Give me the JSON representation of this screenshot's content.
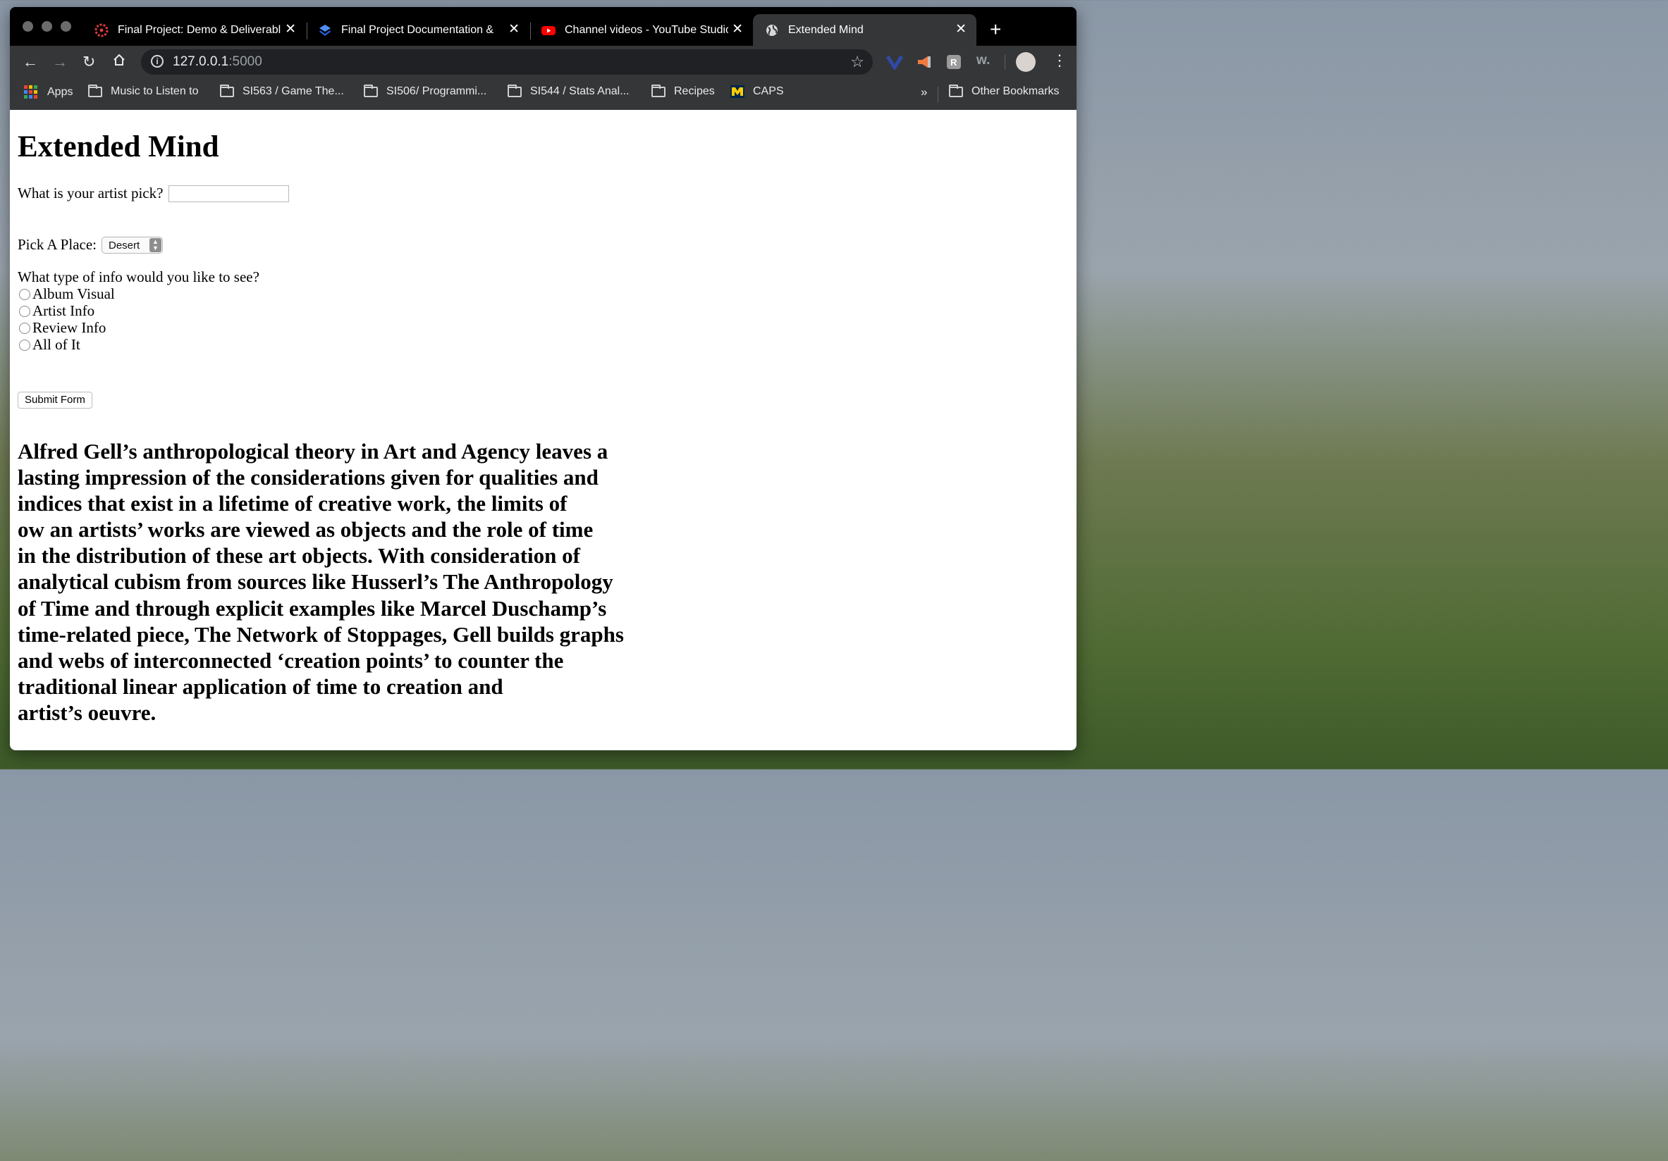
{
  "browser": {
    "tabs": [
      {
        "title": "Final Project: Demo & Deliverabl",
        "icon": "canvas-icon",
        "active": false
      },
      {
        "title": "Final Project Documentation & ",
        "icon": "layers-icon",
        "active": false
      },
      {
        "title": "Channel videos - YouTube Studio",
        "icon": "youtube-icon",
        "active": false
      },
      {
        "title": "Extended Mind",
        "icon": "globe-icon",
        "active": true
      }
    ],
    "url_host": "127.0.0.1",
    "url_port": ":5000",
    "bookmarks": [
      {
        "label": "Apps",
        "icon": "apps-grid-icon"
      },
      {
        "label": "Music to Listen to",
        "icon": "folder-icon"
      },
      {
        "label": "SI563 / Game The...",
        "icon": "folder-icon"
      },
      {
        "label": "SI506/ Programmi...",
        "icon": "folder-icon"
      },
      {
        "label": "SI544 / Stats Anal...",
        "icon": "folder-icon"
      },
      {
        "label": "Recipes",
        "icon": "folder-icon"
      },
      {
        "label": "CAPS",
        "icon": "michigan-m-icon"
      }
    ],
    "overflow": "»",
    "other_bookmarks": "Other Bookmarks",
    "extension_w": "w."
  },
  "page": {
    "title": "Extended Mind",
    "artist_question": "What is your artist pick?",
    "artist_value": "",
    "place_label": "Pick A Place:",
    "place_selected": "Desert",
    "info_question": "What type of info would you like to see?",
    "info_options": [
      "Album Visual",
      "Artist Info",
      "Review Info",
      "All of It"
    ],
    "submit_label": "Submit Form",
    "essay_lines": [
      "Alfred Gell’s anthropological theory in Art and Agency leaves a",
      "lasting impression of the considerations given for qualities and",
      "indices that exist in a lifetime of creative work, the limits of",
      "ow an artists’ works are viewed as objects and the role of time",
      "in the distribution of these art objects. With consideration of",
      "analytical cubism from sources like Husserl’s The Anthropology",
      "of Time and through explicit examples like Marcel Duschamp’s",
      "time-related piece, The Network of Stoppages, Gell builds graphs",
      "and webs of interconnected ‘creation points’ to counter the",
      "traditional linear application of time to creation and",
      "artist’s oeuvre."
    ]
  },
  "colors": {
    "tab_strip": "#000000",
    "toolbar": "#353638",
    "omnibox": "#202124",
    "page_bg": "#ffffff",
    "youtube_red": "#ff0000",
    "canvas_red": "#e4393c",
    "michigan_yellow": "#ffcb05"
  }
}
